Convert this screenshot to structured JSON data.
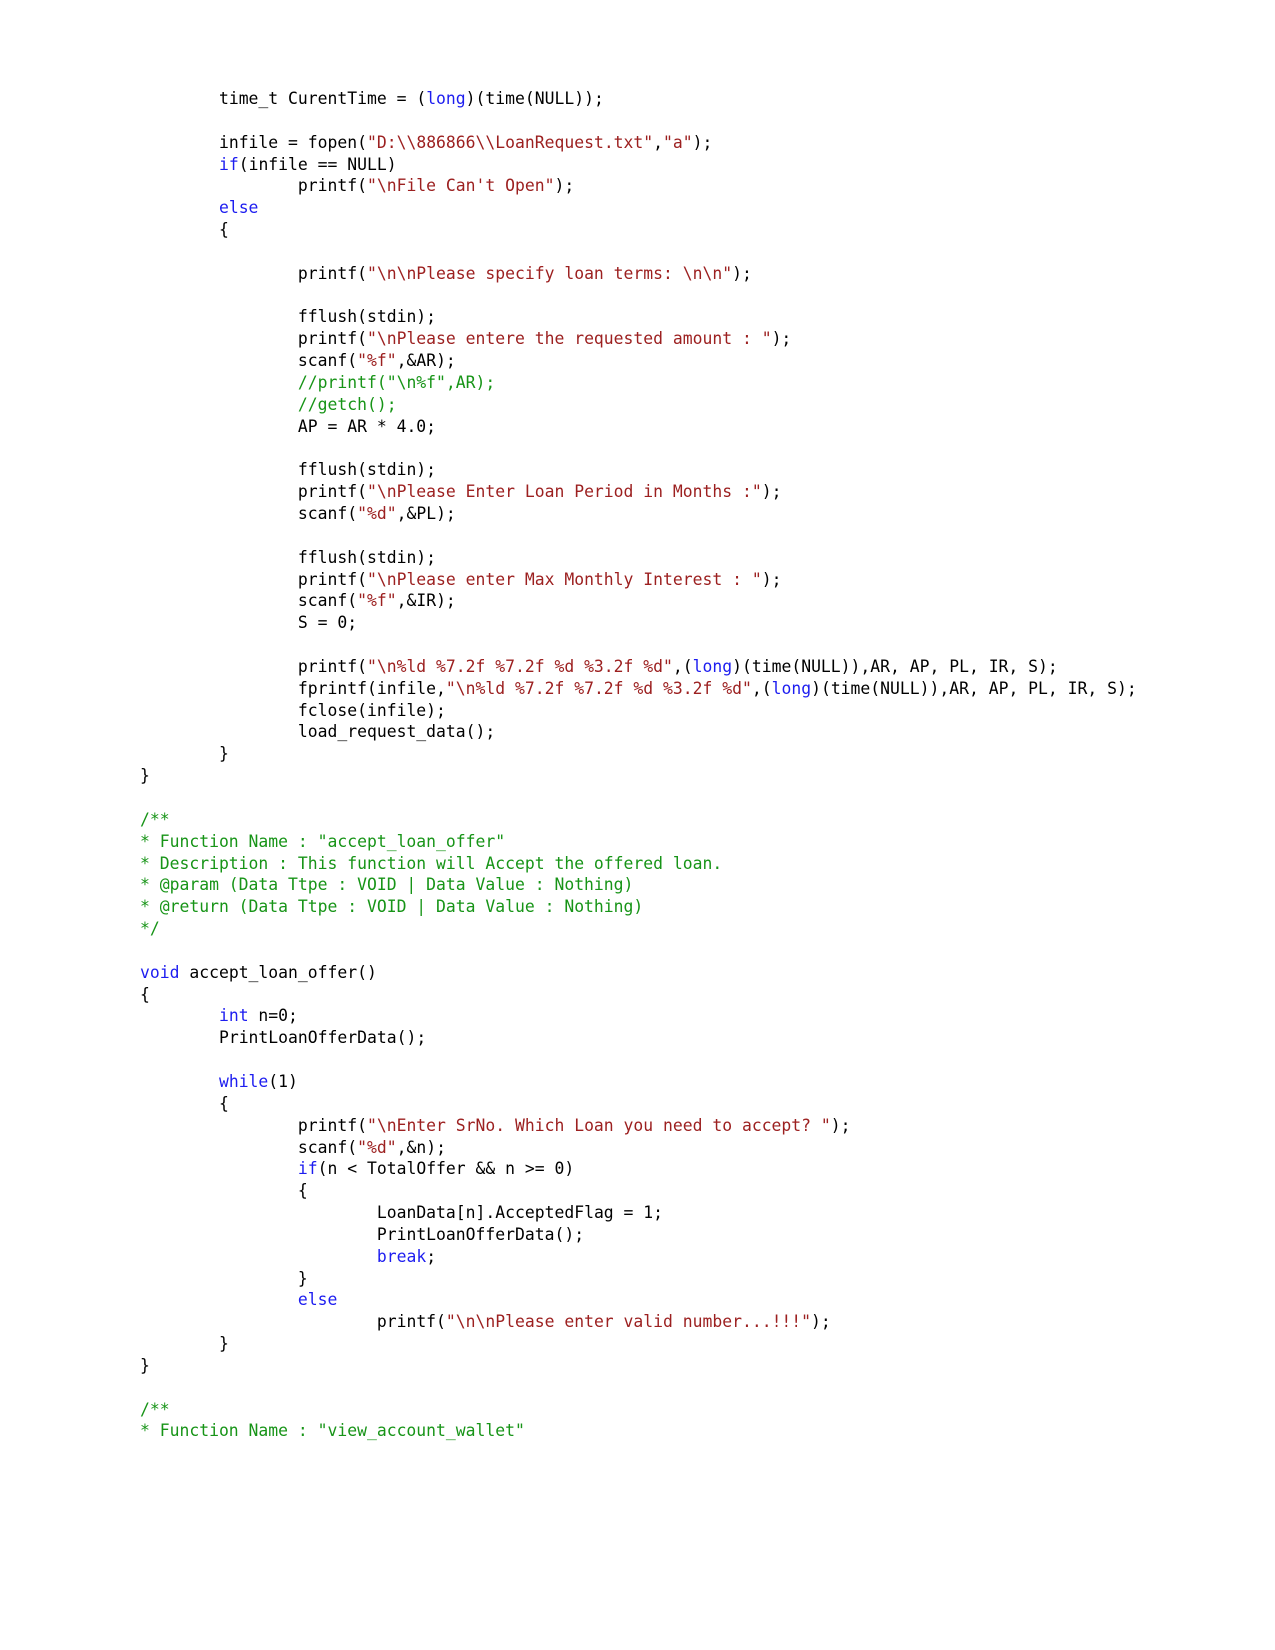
{
  "document": {
    "type": "source-code-listing",
    "language": "C",
    "page_background": "#ffffff",
    "colors": {
      "plain": "#000000",
      "keyword": "#1d1df0",
      "string": "#9c2020",
      "comment": "#179417"
    }
  },
  "code": {
    "lines": [
      {
        "id": "l1",
        "segments": [
          {
            "t": "        time_t CurentTime = (",
            "c": "pln"
          },
          {
            "t": "long",
            "c": "kw"
          },
          {
            "t": ")(time(NULL));",
            "c": "pln"
          }
        ]
      },
      {
        "id": "l2",
        "blank": true
      },
      {
        "id": "l3",
        "segments": [
          {
            "t": "        infile = fopen(",
            "c": "pln"
          },
          {
            "t": "\"D:\\\\886866\\\\LoanRequest.txt\"",
            "c": "str"
          },
          {
            "t": ",",
            "c": "pln"
          },
          {
            "t": "\"a\"",
            "c": "str"
          },
          {
            "t": ");",
            "c": "pln"
          }
        ]
      },
      {
        "id": "l4",
        "segments": [
          {
            "t": "        ",
            "c": "pln"
          },
          {
            "t": "if",
            "c": "kw"
          },
          {
            "t": "(infile == NULL)",
            "c": "pln"
          }
        ]
      },
      {
        "id": "l5",
        "segments": [
          {
            "t": "                printf(",
            "c": "pln"
          },
          {
            "t": "\"\\nFile Can't Open\"",
            "c": "str"
          },
          {
            "t": ");",
            "c": "pln"
          }
        ]
      },
      {
        "id": "l6",
        "segments": [
          {
            "t": "        ",
            "c": "pln"
          },
          {
            "t": "else",
            "c": "kw"
          }
        ]
      },
      {
        "id": "l7",
        "segments": [
          {
            "t": "        {",
            "c": "pln"
          }
        ]
      },
      {
        "id": "l8",
        "blank": true
      },
      {
        "id": "l9",
        "segments": [
          {
            "t": "                printf(",
            "c": "pln"
          },
          {
            "t": "\"\\n\\nPlease specify loan terms: \\n\\n\"",
            "c": "str"
          },
          {
            "t": ");",
            "c": "pln"
          }
        ]
      },
      {
        "id": "l10",
        "blank": true
      },
      {
        "id": "l11",
        "segments": [
          {
            "t": "                fflush(stdin);",
            "c": "pln"
          }
        ]
      },
      {
        "id": "l12",
        "segments": [
          {
            "t": "                printf(",
            "c": "pln"
          },
          {
            "t": "\"\\nPlease entere the requested amount : \"",
            "c": "str"
          },
          {
            "t": ");",
            "c": "pln"
          }
        ]
      },
      {
        "id": "l13",
        "segments": [
          {
            "t": "                scanf(",
            "c": "pln"
          },
          {
            "t": "\"%f\"",
            "c": "str"
          },
          {
            "t": ",&AR);",
            "c": "pln"
          }
        ]
      },
      {
        "id": "l14",
        "segments": [
          {
            "t": "                //printf(\"\\n%f\",AR);",
            "c": "cmt"
          }
        ]
      },
      {
        "id": "l15",
        "segments": [
          {
            "t": "                //getch();",
            "c": "cmt"
          }
        ]
      },
      {
        "id": "l16",
        "segments": [
          {
            "t": "                AP = AR * 4.0;",
            "c": "pln"
          }
        ]
      },
      {
        "id": "l17",
        "blank": true
      },
      {
        "id": "l18",
        "segments": [
          {
            "t": "                fflush(stdin);",
            "c": "pln"
          }
        ]
      },
      {
        "id": "l19",
        "segments": [
          {
            "t": "                printf(",
            "c": "pln"
          },
          {
            "t": "\"\\nPlease Enter Loan Period in Months :\"",
            "c": "str"
          },
          {
            "t": ");",
            "c": "pln"
          }
        ]
      },
      {
        "id": "l20",
        "segments": [
          {
            "t": "                scanf(",
            "c": "pln"
          },
          {
            "t": "\"%d\"",
            "c": "str"
          },
          {
            "t": ",&PL);",
            "c": "pln"
          }
        ]
      },
      {
        "id": "l21",
        "blank": true
      },
      {
        "id": "l22",
        "segments": [
          {
            "t": "                fflush(stdin);",
            "c": "pln"
          }
        ]
      },
      {
        "id": "l23",
        "segments": [
          {
            "t": "                printf(",
            "c": "pln"
          },
          {
            "t": "\"\\nPlease enter Max Monthly Interest : \"",
            "c": "str"
          },
          {
            "t": ");",
            "c": "pln"
          }
        ]
      },
      {
        "id": "l24",
        "segments": [
          {
            "t": "                scanf(",
            "c": "pln"
          },
          {
            "t": "\"%f\"",
            "c": "str"
          },
          {
            "t": ",&IR);",
            "c": "pln"
          }
        ]
      },
      {
        "id": "l25",
        "segments": [
          {
            "t": "                S = 0;",
            "c": "pln"
          }
        ]
      },
      {
        "id": "l26",
        "blank": true
      },
      {
        "id": "l27",
        "segments": [
          {
            "t": "                printf(",
            "c": "pln"
          },
          {
            "t": "\"\\n%ld %7.2f %7.2f %d %3.2f %d\"",
            "c": "str"
          },
          {
            "t": ",(",
            "c": "pln"
          },
          {
            "t": "long",
            "c": "kw"
          },
          {
            "t": ")(time(NULL)),AR, AP, PL, IR, S);",
            "c": "pln"
          }
        ]
      },
      {
        "id": "l28",
        "segments": [
          {
            "t": "                fprintf(infile,",
            "c": "pln"
          },
          {
            "t": "\"\\n%ld %7.2f %7.2f %d %3.2f %d\"",
            "c": "str"
          },
          {
            "t": ",(",
            "c": "pln"
          },
          {
            "t": "long",
            "c": "kw"
          },
          {
            "t": ")(time(NULL)),AR, AP, PL, IR, S);",
            "c": "pln"
          }
        ]
      },
      {
        "id": "l29",
        "segments": [
          {
            "t": "                fclose(infile);",
            "c": "pln"
          }
        ]
      },
      {
        "id": "l30",
        "segments": [
          {
            "t": "                load_request_data();",
            "c": "pln"
          }
        ]
      },
      {
        "id": "l31",
        "segments": [
          {
            "t": "        }",
            "c": "pln"
          }
        ]
      },
      {
        "id": "l32",
        "segments": [
          {
            "t": "}",
            "c": "pln"
          }
        ]
      },
      {
        "id": "l33",
        "blank": true
      },
      {
        "id": "l34",
        "segments": [
          {
            "t": "/**",
            "c": "cmt"
          }
        ]
      },
      {
        "id": "l35",
        "segments": [
          {
            "t": "* Function Name : \"accept_loan_offer\"",
            "c": "cmt"
          }
        ]
      },
      {
        "id": "l36",
        "segments": [
          {
            "t": "* Description : This function will Accept the offered loan.",
            "c": "cmt"
          }
        ]
      },
      {
        "id": "l37",
        "segments": [
          {
            "t": "* @param (Data Ttpe : VOID | Data Value : Nothing)",
            "c": "cmt"
          }
        ]
      },
      {
        "id": "l38",
        "segments": [
          {
            "t": "* @return (Data Ttpe : VOID | Data Value : Nothing)",
            "c": "cmt"
          }
        ]
      },
      {
        "id": "l39",
        "segments": [
          {
            "t": "*/",
            "c": "cmt"
          }
        ]
      },
      {
        "id": "l40",
        "blank": true
      },
      {
        "id": "l41",
        "segments": [
          {
            "t": "void",
            "c": "kw"
          },
          {
            "t": " accept_loan_offer()",
            "c": "pln"
          }
        ]
      },
      {
        "id": "l42",
        "segments": [
          {
            "t": "{",
            "c": "pln"
          }
        ]
      },
      {
        "id": "l43",
        "segments": [
          {
            "t": "        ",
            "c": "pln"
          },
          {
            "t": "int",
            "c": "kw"
          },
          {
            "t": " n=0;",
            "c": "pln"
          }
        ]
      },
      {
        "id": "l44",
        "segments": [
          {
            "t": "        PrintLoanOfferData();",
            "c": "pln"
          }
        ]
      },
      {
        "id": "l45",
        "blank": true
      },
      {
        "id": "l46",
        "segments": [
          {
            "t": "        ",
            "c": "pln"
          },
          {
            "t": "while",
            "c": "kw"
          },
          {
            "t": "(1)",
            "c": "pln"
          }
        ]
      },
      {
        "id": "l47",
        "segments": [
          {
            "t": "        {",
            "c": "pln"
          }
        ]
      },
      {
        "id": "l48",
        "segments": [
          {
            "t": "                printf(",
            "c": "pln"
          },
          {
            "t": "\"\\nEnter SrNo. Which Loan you need to accept? \"",
            "c": "str"
          },
          {
            "t": ");",
            "c": "pln"
          }
        ]
      },
      {
        "id": "l49",
        "segments": [
          {
            "t": "                scanf(",
            "c": "pln"
          },
          {
            "t": "\"%d\"",
            "c": "str"
          },
          {
            "t": ",&n);",
            "c": "pln"
          }
        ]
      },
      {
        "id": "l50",
        "segments": [
          {
            "t": "                ",
            "c": "pln"
          },
          {
            "t": "if",
            "c": "kw"
          },
          {
            "t": "(n < TotalOffer && n >= 0)",
            "c": "pln"
          }
        ]
      },
      {
        "id": "l51",
        "segments": [
          {
            "t": "                {",
            "c": "pln"
          }
        ]
      },
      {
        "id": "l52",
        "segments": [
          {
            "t": "                        LoanData[n].AcceptedFlag = 1;",
            "c": "pln"
          }
        ]
      },
      {
        "id": "l53",
        "segments": [
          {
            "t": "                        PrintLoanOfferData();",
            "c": "pln"
          }
        ]
      },
      {
        "id": "l54",
        "segments": [
          {
            "t": "                        ",
            "c": "pln"
          },
          {
            "t": "break",
            "c": "kw"
          },
          {
            "t": ";",
            "c": "pln"
          }
        ]
      },
      {
        "id": "l55",
        "segments": [
          {
            "t": "                }",
            "c": "pln"
          }
        ]
      },
      {
        "id": "l56",
        "segments": [
          {
            "t": "                ",
            "c": "pln"
          },
          {
            "t": "else",
            "c": "kw"
          }
        ]
      },
      {
        "id": "l57",
        "segments": [
          {
            "t": "                        printf(",
            "c": "pln"
          },
          {
            "t": "\"\\n\\nPlease enter valid number...!!!\"",
            "c": "str"
          },
          {
            "t": ");",
            "c": "pln"
          }
        ]
      },
      {
        "id": "l58",
        "segments": [
          {
            "t": "        }",
            "c": "pln"
          }
        ]
      },
      {
        "id": "l59",
        "segments": [
          {
            "t": "}",
            "c": "pln"
          }
        ]
      },
      {
        "id": "l60",
        "blank": true
      },
      {
        "id": "l61",
        "segments": [
          {
            "t": "/**",
            "c": "cmt"
          }
        ]
      },
      {
        "id": "l62",
        "segments": [
          {
            "t": "* Function Name : \"view_account_wallet\"",
            "c": "cmt"
          }
        ]
      }
    ]
  }
}
